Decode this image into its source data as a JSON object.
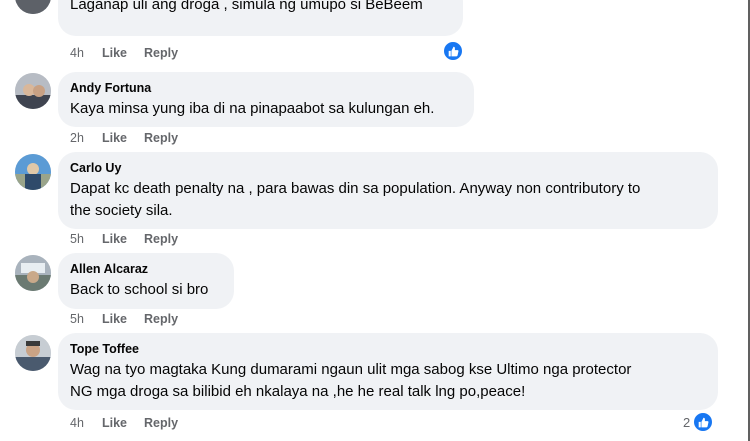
{
  "comments": [
    {
      "author": "",
      "text": "Laganap uli ang droga , simula ng umupo si BeBeem",
      "time": "4h",
      "like": "Like",
      "reply": "Reply",
      "reaction_count": ""
    },
    {
      "author": "Andy Fortuna",
      "text": "Kaya minsa yung iba di na pinapaabot sa kulungan eh.",
      "time": "2h",
      "like": "Like",
      "reply": "Reply"
    },
    {
      "author": "Carlo Uy",
      "text": "Dapat kc death penalty na , para bawas din sa population. Anyway non contributory to\nthe society sila.",
      "time": "5h",
      "like": "Like",
      "reply": "Reply"
    },
    {
      "author": "Allen Alcaraz",
      "text": "Back to school si bro",
      "time": "5h",
      "like": "Like",
      "reply": "Reply"
    },
    {
      "author": "Tope Toffee",
      "text": "Wag na tyo magtaka Kung dumarami ngaun ulit mga sabog kse Ultimo nga protector\nNG mga droga sa bilibid eh nkalaya na ,he he real talk lng po,peace!",
      "time": "4h",
      "like": "Like",
      "reply": "Reply",
      "reaction_count": "2"
    }
  ],
  "colors": {
    "bubble": "#f0f2f5",
    "meta": "#65676b",
    "like_blue": "#1877f2"
  },
  "icons": {
    "reaction": "like-reaction-icon",
    "avatar": "profile-avatar"
  }
}
